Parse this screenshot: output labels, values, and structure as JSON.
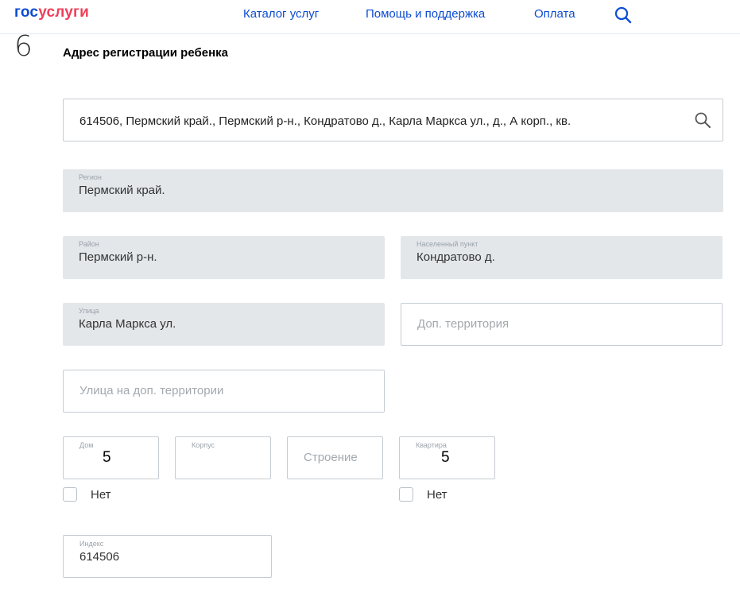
{
  "header": {
    "logo_gos": "гос",
    "logo_uslugi": "услуги",
    "nav": [
      "Каталог услуг",
      "Помощь и поддержка",
      "Оплата"
    ],
    "search_icon": "search-icon",
    "colors": {
      "brand_blue": "#0d4cd3",
      "brand_red": "#ee3f58"
    }
  },
  "section": {
    "step": "6",
    "title": "Адрес регистрации ребенка"
  },
  "address_search": {
    "value": "614506, Пермский край., Пермский р-н., Кондратово д., Карла Маркса ул.,      д., А корп.,      кв.",
    "icon": "search-icon"
  },
  "fields": {
    "region": {
      "label": "Регион",
      "value": "Пермский край."
    },
    "district": {
      "label": "Район",
      "value": "Пермский р-н."
    },
    "settlement": {
      "label": "Населенный пункт",
      "value": "Кондратово д."
    },
    "street": {
      "label": "Улица",
      "value": "Карла Маркса ул."
    },
    "extra_territory": {
      "placeholder": "Доп. территория"
    },
    "extra_street": {
      "placeholder": "Улица на доп. территории"
    },
    "house": {
      "label": "Дом",
      "value": "5"
    },
    "corpus": {
      "label": "Корпус",
      "value": ""
    },
    "building": {
      "placeholder": "Строение"
    },
    "apartment": {
      "label": "Квартира",
      "value": "5"
    },
    "index": {
      "label": "Индекс",
      "value": "614506"
    }
  },
  "checkboxes": {
    "no_house": {
      "label": "Нет",
      "checked": false
    },
    "no_apartment": {
      "label": "Нет",
      "checked": false
    }
  }
}
